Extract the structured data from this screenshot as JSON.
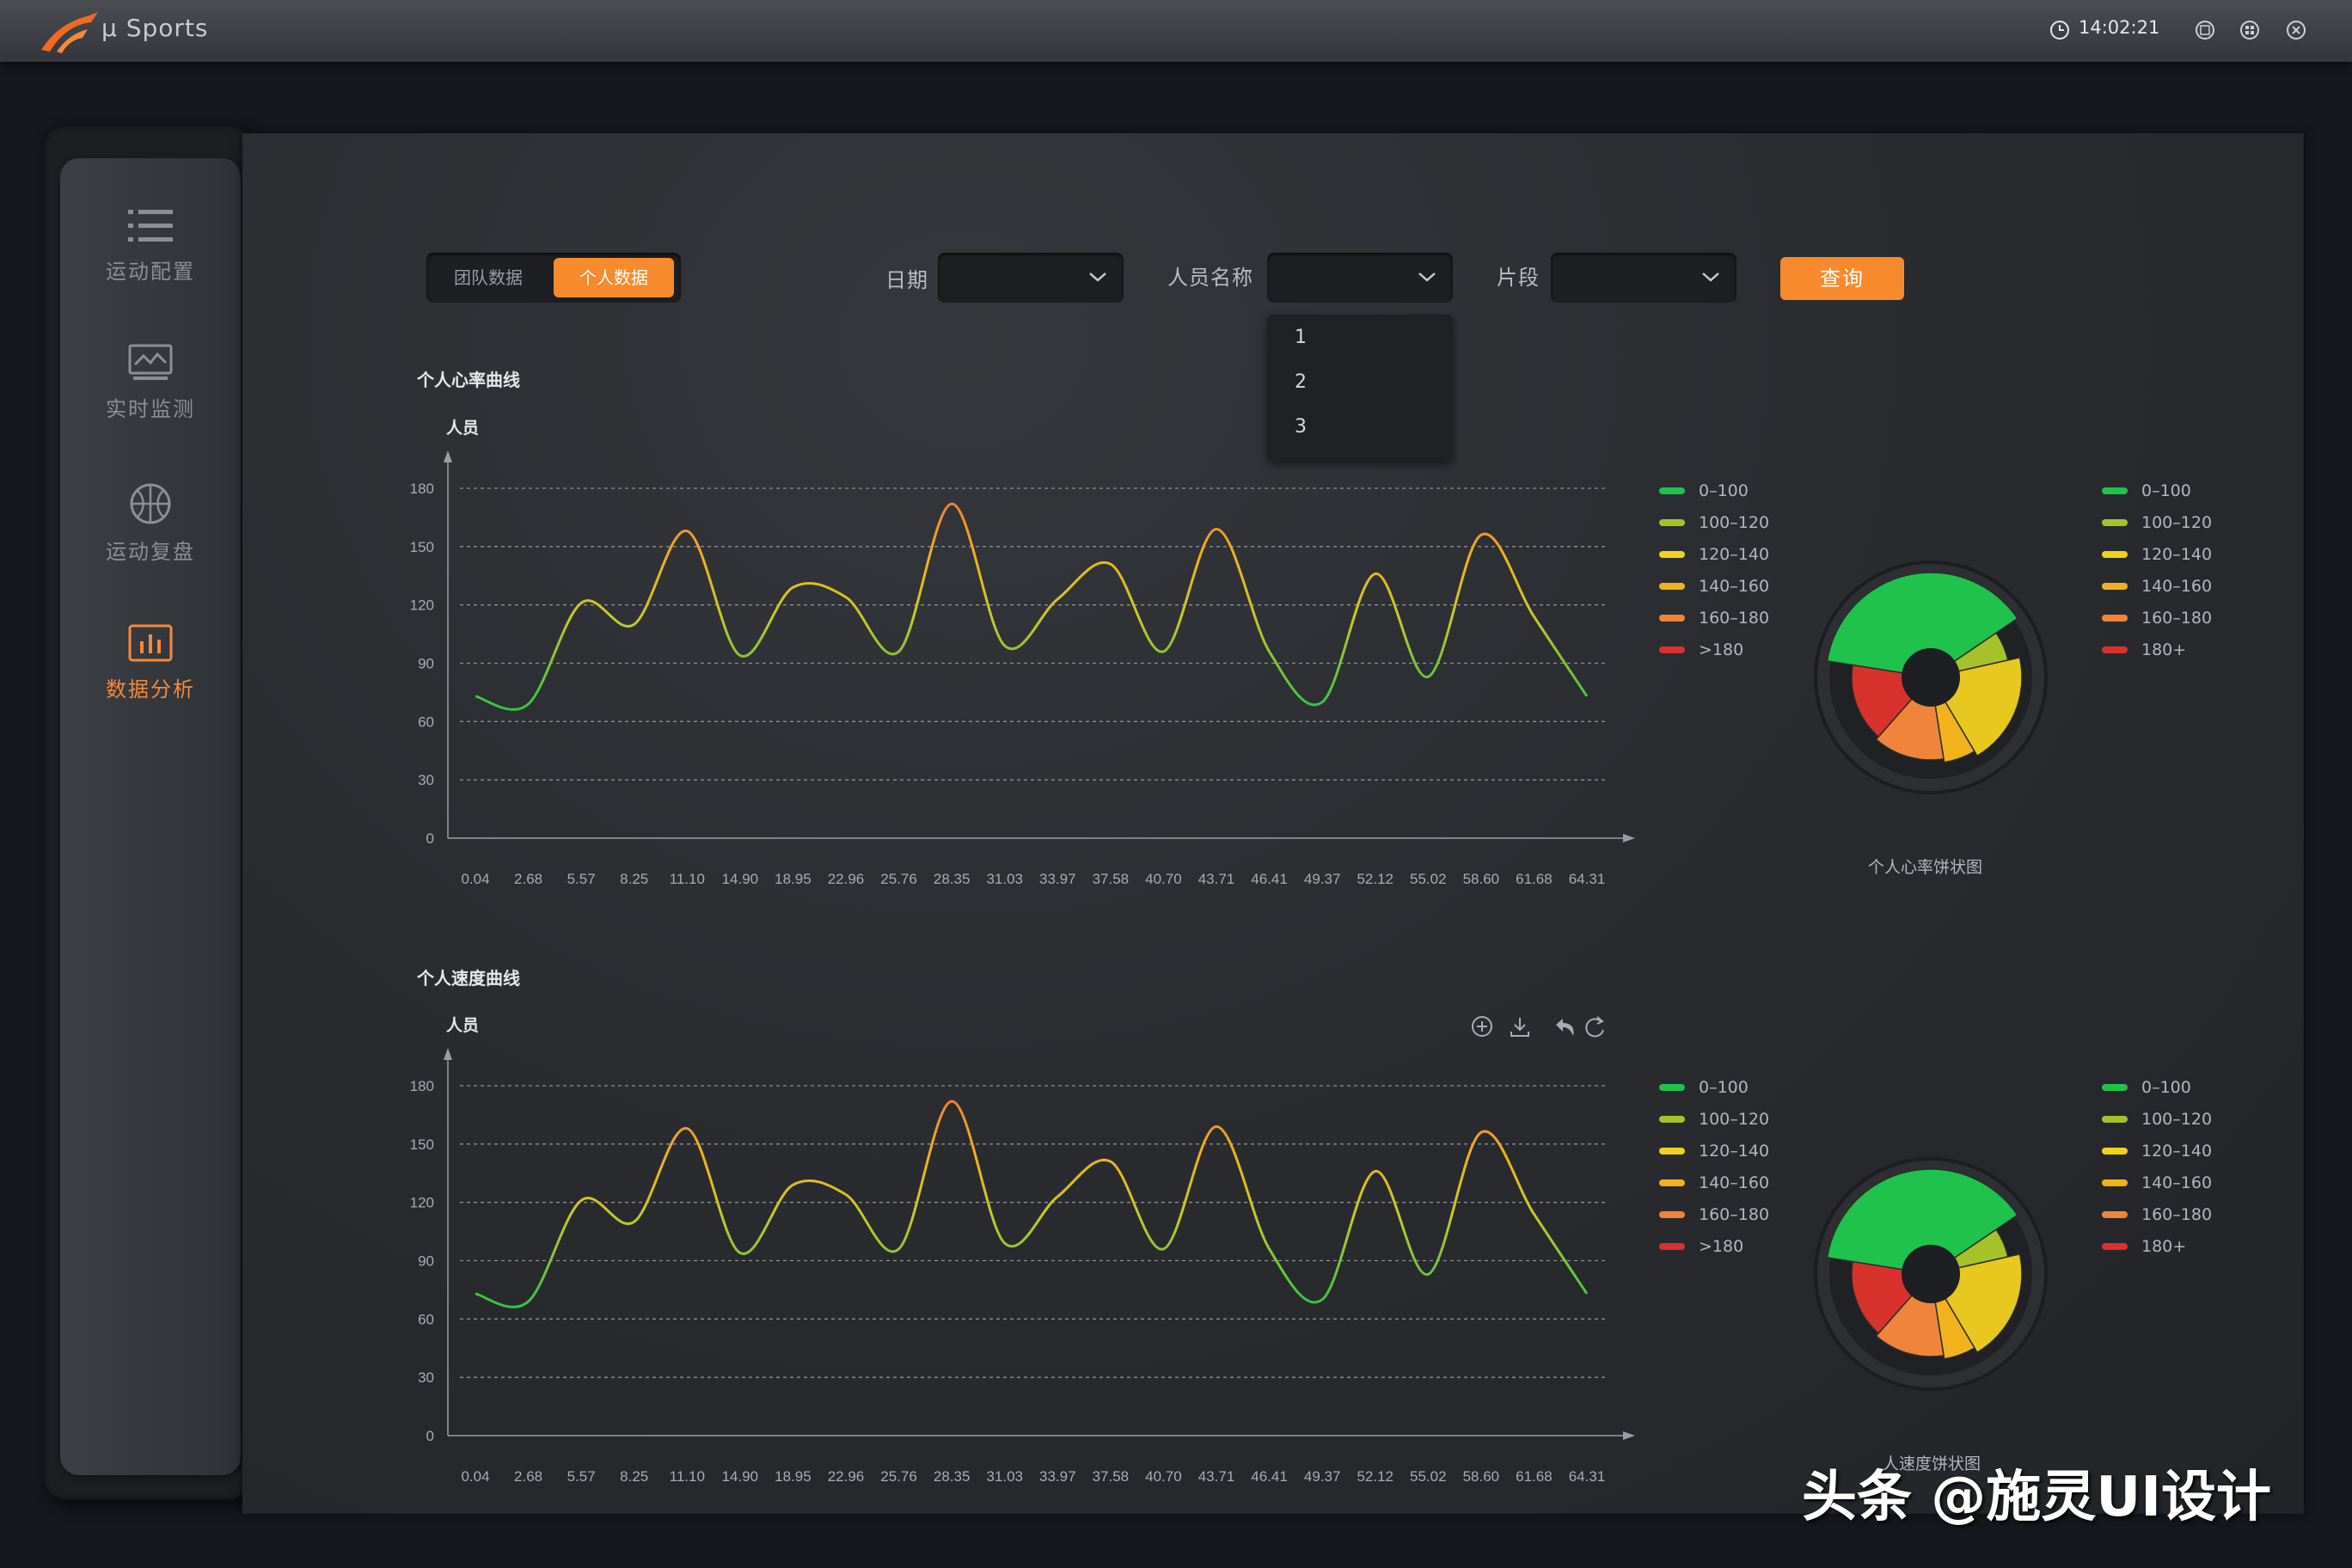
{
  "app": {
    "title": "μ Sports",
    "time": "14:02:21",
    "brand_color": "#f78a2c"
  },
  "sidebar": {
    "items": [
      {
        "label": "运动配置",
        "icon": "list-icon",
        "active": false
      },
      {
        "label": "实时监测",
        "icon": "monitor-icon",
        "active": false
      },
      {
        "label": "运动复盘",
        "icon": "basketball-icon",
        "active": false
      },
      {
        "label": "数据分析",
        "icon": "bar-chart-icon",
        "active": true
      }
    ]
  },
  "filters": {
    "tabs": [
      "团队数据",
      "个人数据"
    ],
    "active_tab": "个人数据",
    "date_label": "日期",
    "person_label": "人员名称",
    "segment_label": "片段",
    "date_value": "",
    "person_value": "",
    "segment_value": "",
    "person_options": [
      "1",
      "2",
      "3"
    ],
    "query_label": "查询"
  },
  "heart": {
    "title": "个人心率曲线",
    "pie_caption": "个人心率饼状图"
  },
  "speed": {
    "title": "个人速度曲线",
    "pie_caption": "人速度饼状图"
  },
  "legend_left": [
    "0–100",
    "100–120",
    "120–140",
    "140–160",
    "160–180",
    ">180"
  ],
  "legend_right": [
    "0–100",
    "100–120",
    "120–140",
    "140–160",
    "160–180",
    "180+"
  ],
  "legend_colors": [
    "#1fc24a",
    "#a6c22a",
    "#f0d21e",
    "#f2b21e",
    "#f0843a",
    "#d8322c"
  ],
  "toolbox": [
    "zoom-icon",
    "download-icon",
    "undo-icon",
    "refresh-icon"
  ],
  "watermark": "头条 @施灵UI设计",
  "chart_data": [
    {
      "type": "line",
      "title": "个人心率曲线",
      "ylabel": "人员",
      "ylim": [
        0,
        180
      ],
      "yticks": [
        0,
        30,
        60,
        90,
        120,
        150,
        180
      ],
      "categories": [
        "0.04",
        "2.68",
        "5.57",
        "8.25",
        "11.10",
        "14.90",
        "18.95",
        "22.96",
        "25.76",
        "28.35",
        "31.03",
        "33.97",
        "37.58",
        "40.70",
        "43.71",
        "46.41",
        "49.37",
        "52.12",
        "55.02",
        "58.60",
        "61.68",
        "64.31"
      ],
      "series": [
        {
          "values": [
            73,
            69,
            121,
            110,
            158,
            94,
            129,
            124,
            96,
            172,
            99,
            123,
            141,
            96,
            159,
            96,
            70,
            136,
            83,
            156,
            114,
            73
          ]
        }
      ],
      "grid": true
    },
    {
      "type": "pie",
      "title": "个人心率饼状图",
      "categories": [
        "0-100",
        "100-120",
        "120-140",
        "140-160",
        "160-180",
        "180+"
      ],
      "values": [
        38,
        6,
        20,
        6,
        14,
        16
      ]
    },
    {
      "type": "line",
      "title": "个人速度曲线",
      "ylabel": "人员",
      "ylim": [
        0,
        180
      ],
      "yticks": [
        0,
        30,
        60,
        90,
        120,
        150,
        180
      ],
      "categories": [
        "0.04",
        "2.68",
        "5.57",
        "8.25",
        "11.10",
        "14.90",
        "18.95",
        "22.96",
        "25.76",
        "28.35",
        "31.03",
        "33.97",
        "37.58",
        "40.70",
        "43.71",
        "46.41",
        "49.37",
        "52.12",
        "55.02",
        "58.60",
        "61.68",
        "64.31"
      ],
      "series": [
        {
          "values": [
            73,
            69,
            121,
            110,
            158,
            94,
            129,
            124,
            96,
            172,
            99,
            123,
            141,
            96,
            159,
            96,
            70,
            136,
            83,
            156,
            114,
            73
          ]
        }
      ],
      "grid": true
    },
    {
      "type": "pie",
      "title": "人速度饼状图",
      "categories": [
        "0-100",
        "100-120",
        "120-140",
        "140-160",
        "160-180",
        "180+"
      ],
      "values": [
        38,
        6,
        20,
        6,
        14,
        16
      ]
    }
  ]
}
